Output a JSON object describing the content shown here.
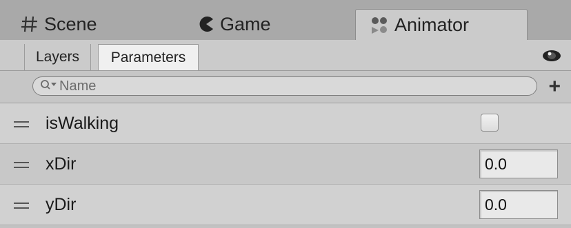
{
  "window_tabs": [
    {
      "label": "Scene",
      "icon": "grid-icon"
    },
    {
      "label": "Game",
      "icon": "pacman-icon"
    },
    {
      "label": "Animator",
      "icon": "animator-icon",
      "active": true
    }
  ],
  "sub_tabs": [
    {
      "label": "Layers",
      "active": false
    },
    {
      "label": "Parameters",
      "active": true
    }
  ],
  "toolbar": {
    "visibility_icon": "eye-icon",
    "add_icon": "plus-icon",
    "add_label": "+"
  },
  "search": {
    "placeholder": "Name",
    "value": "",
    "icon": "search-dropdown-icon"
  },
  "parameters": [
    {
      "name": "isWalking",
      "type": "bool",
      "value": false
    },
    {
      "name": "xDir",
      "type": "float",
      "value": "0.0"
    },
    {
      "name": "yDir",
      "type": "float",
      "value": "0.0"
    }
  ],
  "colors": {
    "accent_tab": "#cbcbcb",
    "background": "#c2c2c2"
  }
}
